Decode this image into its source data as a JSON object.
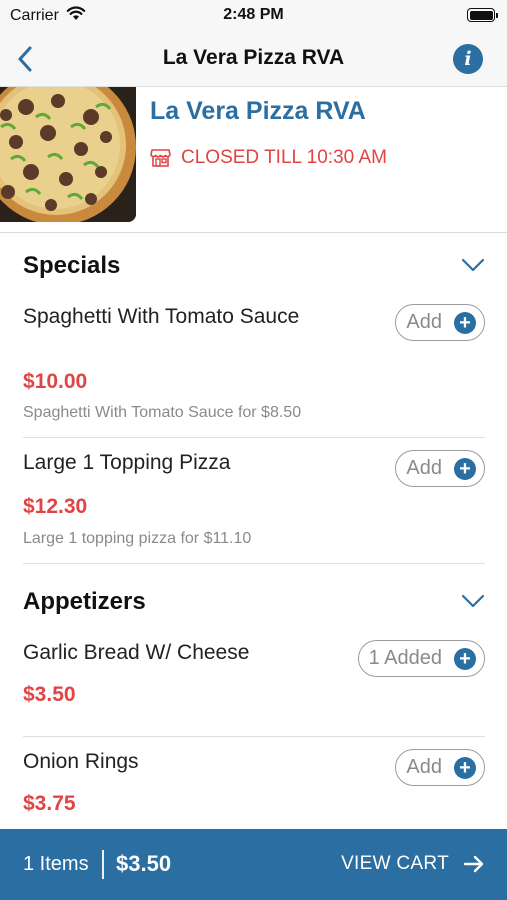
{
  "status_bar": {
    "carrier": "Carrier",
    "time": "2:48 PM"
  },
  "nav": {
    "title": "La Vera Pizza RVA"
  },
  "restaurant": {
    "name": "La Vera Pizza RVA",
    "status": "CLOSED TILL 10:30 AM"
  },
  "sections": [
    {
      "title": "Specials",
      "items": [
        {
          "name": "Spaghetti With Tomato Sauce",
          "price": "$10.00",
          "description": "Spaghetti With Tomato Sauce for $8.50",
          "button": "Add"
        },
        {
          "name": "Large 1 Topping Pizza",
          "price": "$12.30",
          "description": "Large 1 topping pizza for $11.10",
          "button": "Add"
        }
      ]
    },
    {
      "title": "Appetizers",
      "items": [
        {
          "name": "Garlic Bread W/ Cheese",
          "price": "$3.50",
          "button": "1 Added"
        },
        {
          "name": "Onion Rings",
          "price": "$3.75",
          "button": "Add"
        }
      ]
    }
  ],
  "cart": {
    "items": "1 Items",
    "total": "$3.50",
    "view_label": "VIEW CART"
  },
  "colors": {
    "accent": "#2a6ea2",
    "closed": "#e04444",
    "price": "#e04444"
  },
  "icons": [
    "wifi-icon",
    "battery-icon",
    "back-chevron-icon",
    "info-icon",
    "store-icon",
    "chevron-down-icon",
    "plus-icon",
    "arrow-right-icon"
  ]
}
